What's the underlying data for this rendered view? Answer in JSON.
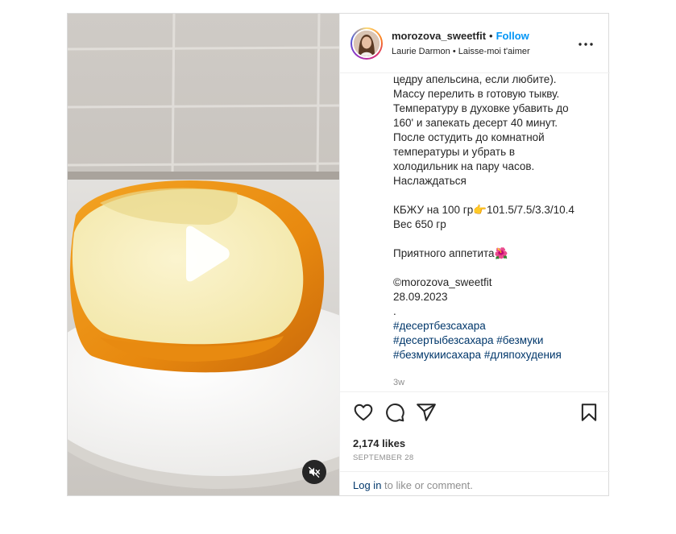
{
  "post": {
    "username": "morozova_sweetfit",
    "separator": "•",
    "follow_label": "Follow",
    "audio": {
      "artist": "Laurie Darmon",
      "separator": "•",
      "track": "Laisse-moi t'aimer"
    },
    "more_icon": "more-horizontal-icon",
    "caption_lines": [
      "цедру апельсина, если любите).",
      "Массу перелить в готовую тыкву.",
      "Температуру в духовке убавить до",
      "160' и запекать десерт 40 минут.",
      "После остудить до комнатной",
      "температуры и убрать в",
      "холодильник на пару часов.",
      "Наслаждаться",
      "",
      "КБЖУ на 100 гр👉101.5/7.5/3.3/10.4",
      "Вес 650 гр",
      "",
      "Приятного аппетита🌺",
      "",
      "©morozova_sweetfit",
      "28.09.2023",
      "."
    ],
    "hashtag_lines": [
      [
        "#десертбезсахара"
      ],
      [
        "#десертыбезсахара",
        "#безмуки"
      ],
      [
        "#безмукиисахара",
        "#дляпохудения"
      ]
    ],
    "caption_time": "3w",
    "likes_text": "2,174 likes",
    "date_text": "SEPTEMBER 28",
    "login": {
      "link": "Log in",
      "rest": " to like or comment."
    },
    "actions": [
      "heart-icon",
      "comment-icon",
      "share-icon",
      "bookmark-icon"
    ],
    "media_controls": [
      "play-icon",
      "mute-icon"
    ]
  },
  "colors": {
    "link_blue": "#0095f6",
    "hashtag": "#00376b",
    "muted": "#8e8e8e",
    "border": "#dbdbdb"
  }
}
